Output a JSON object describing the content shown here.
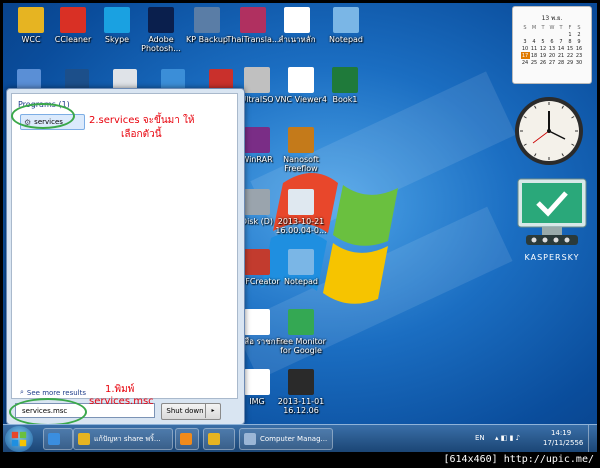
{
  "desktop": {
    "top_icons": [
      {
        "label": "WCC",
        "icon": "folder-icon",
        "color": "#e6b422"
      },
      {
        "label": "CCleaner",
        "icon": "ccleaner-icon",
        "color": "#d93025"
      },
      {
        "label": "Skype",
        "icon": "skype-icon",
        "color": "#1aa1e1"
      },
      {
        "label": "Adobe Photosh...",
        "icon": "photoshop-icon",
        "color": "#0a1f4d"
      },
      {
        "label": "KP Backup",
        "icon": "backup-icon",
        "color": "#5a7da6"
      },
      {
        "label": "ThaiTransla...",
        "icon": "thai-translate-icon",
        "color": "#b03060"
      },
      {
        "label": "สำเนาหลัก",
        "icon": "document-icon",
        "color": "#ffffff"
      },
      {
        "label": "Notepad",
        "icon": "notepad-icon",
        "color": "#7ab6e6"
      }
    ],
    "right_icons": [
      {
        "label": "UltraISO",
        "icon": "disc-icon",
        "color": "#c0c0c0"
      },
      {
        "label": "VNC Viewer4",
        "icon": "vnc-icon",
        "color": "#ffffff"
      },
      {
        "label": "Book1",
        "icon": "excel-icon",
        "color": "#1f7a3a"
      },
      {
        "label": "WinRAR",
        "icon": "winrar-icon",
        "color": "#7a2d86"
      },
      {
        "label": "Nanosoft Freeflow",
        "icon": "box-icon",
        "color": "#c47a1a"
      },
      {
        "label": "Disk (D)",
        "icon": "drive-icon",
        "color": "#9aa4ad"
      },
      {
        "label": "2013-10-21 16.00.04-0...",
        "icon": "image-file-icon",
        "color": "#dfe8f0"
      },
      {
        "label": "PDFCreator",
        "icon": "pdf-icon",
        "color": "#c23b2e"
      },
      {
        "label": "Notepad",
        "icon": "notepad-icon",
        "color": "#7ab6e6"
      },
      {
        "label": "หนังสือ ราชการ",
        "icon": "document-icon",
        "color": "#ffffff"
      },
      {
        "label": "Free Monitor for Google",
        "icon": "monitor-icon",
        "color": "#34a853"
      },
      {
        "label": "IMG",
        "icon": "document-icon",
        "color": "#ffffff"
      },
      {
        "label": "2013-11-01 16.12.06",
        "icon": "image-file-icon",
        "color": "#2a2a2a"
      }
    ]
  },
  "start_menu": {
    "programs_header": "Programs (1)",
    "result": {
      "label": "services",
      "icon": "gear-icon"
    },
    "see_more": "See more results",
    "search_value": "services.msc",
    "shutdown_label": "Shut down"
  },
  "annotations": {
    "step2_line1": "2.services จะขึ้นมา ให้",
    "step2_line2": "เลือกตัวนี้",
    "step1_line1": "1.พิมพ์",
    "step1_line2": "services.msc"
  },
  "taskbar": {
    "items": [
      {
        "label": "",
        "icon": "internet-explorer-icon"
      },
      {
        "label": "แก้ปัญหา share พริ้...",
        "icon": "folder-icon"
      },
      {
        "label": "",
        "icon": "media-player-icon"
      },
      {
        "label": "",
        "icon": "windows-explorer-icon"
      },
      {
        "label": "Computer Manag...",
        "icon": "computer-management-icon"
      }
    ],
    "language": "EN",
    "time": "14:19",
    "date": "17/11/2556"
  },
  "calendar": {
    "title": "13 พ.ย.",
    "headers": [
      "S",
      "M",
      "T",
      "W",
      "T",
      "F",
      "S"
    ],
    "rows": [
      [
        "",
        "",
        "",
        "",
        "",
        "1",
        "2"
      ],
      [
        "3",
        "4",
        "5",
        "6",
        "7",
        "8",
        "9"
      ],
      [
        "10",
        "11",
        "12",
        "13",
        "14",
        "15",
        "16"
      ],
      [
        "17",
        "18",
        "19",
        "20",
        "21",
        "22",
        "23"
      ],
      [
        "24",
        "25",
        "26",
        "27",
        "28",
        "29",
        "30"
      ]
    ],
    "today": "17",
    "accent": "#e07a00"
  },
  "gadgets": {
    "kaspersky_label": "KASPERSKY"
  },
  "watermark": "[614x460] http://upic.me/"
}
